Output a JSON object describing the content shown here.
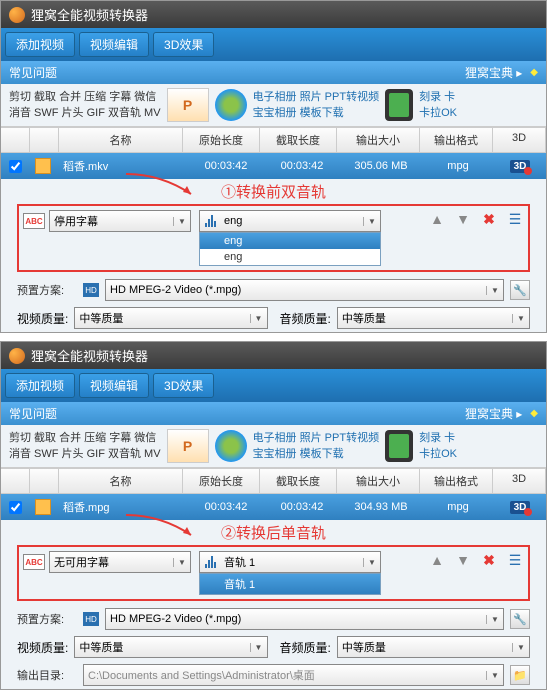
{
  "app": {
    "title": "狸窝全能视频转换器"
  },
  "toolbar": {
    "add": "添加视频",
    "edit": "视频编辑",
    "fx3d": "3D效果"
  },
  "faq": {
    "label": "常见问题",
    "baodian": "狸窝宝典 ▸"
  },
  "links": {
    "blockA": "剪切 截取 合并 压缩 字幕 微信\n消音 SWF 片头 GIF 双音轨 MV",
    "blockB": "电子相册 照片 PPT转视频\n宝宝相册 模板下载",
    "blockC": "刻录 卡\n卡拉OK"
  },
  "headers": {
    "name": "名称",
    "orig": "原始长度",
    "cut": "截取长度",
    "out": "输出大小",
    "fmt": "输出格式",
    "d3": "3D"
  },
  "panel1": {
    "row": {
      "name": "稻香.mkv",
      "orig": "00:03:42",
      "cut": "00:03:42",
      "out": "305.06 MB",
      "fmt": "mpg"
    },
    "anno": "①转换前双音轨",
    "sub_label": "停用字幕",
    "audio_sel": "eng",
    "audio_opts": [
      "eng",
      "eng"
    ],
    "preset_label": "预置方案:",
    "preset_value": "HD MPEG-2 Video (*.mpg)",
    "vq_label": "视频质量:",
    "vq_value": "中等质量",
    "aq_label": "音频质量:",
    "aq_value": "中等质量"
  },
  "panel2": {
    "row": {
      "name": "稻香.mpg",
      "orig": "00:03:42",
      "cut": "00:03:42",
      "out": "304.93 MB",
      "fmt": "mpg"
    },
    "anno": "②转换后单音轨",
    "sub_label": "无可用字幕",
    "audio_sel": "音轨 1",
    "audio_opts": [
      "音轨 1"
    ],
    "preset_label": "预置方案:",
    "preset_value": "HD MPEG-2 Video (*.mpg)",
    "vq_label": "视频质量:",
    "vq_value": "中等质量",
    "aq_label": "音频质量:",
    "aq_value": "中等质量",
    "out_label": "输出目录:",
    "out_value": "C:\\Documents and Settings\\Administrator\\桌面"
  }
}
